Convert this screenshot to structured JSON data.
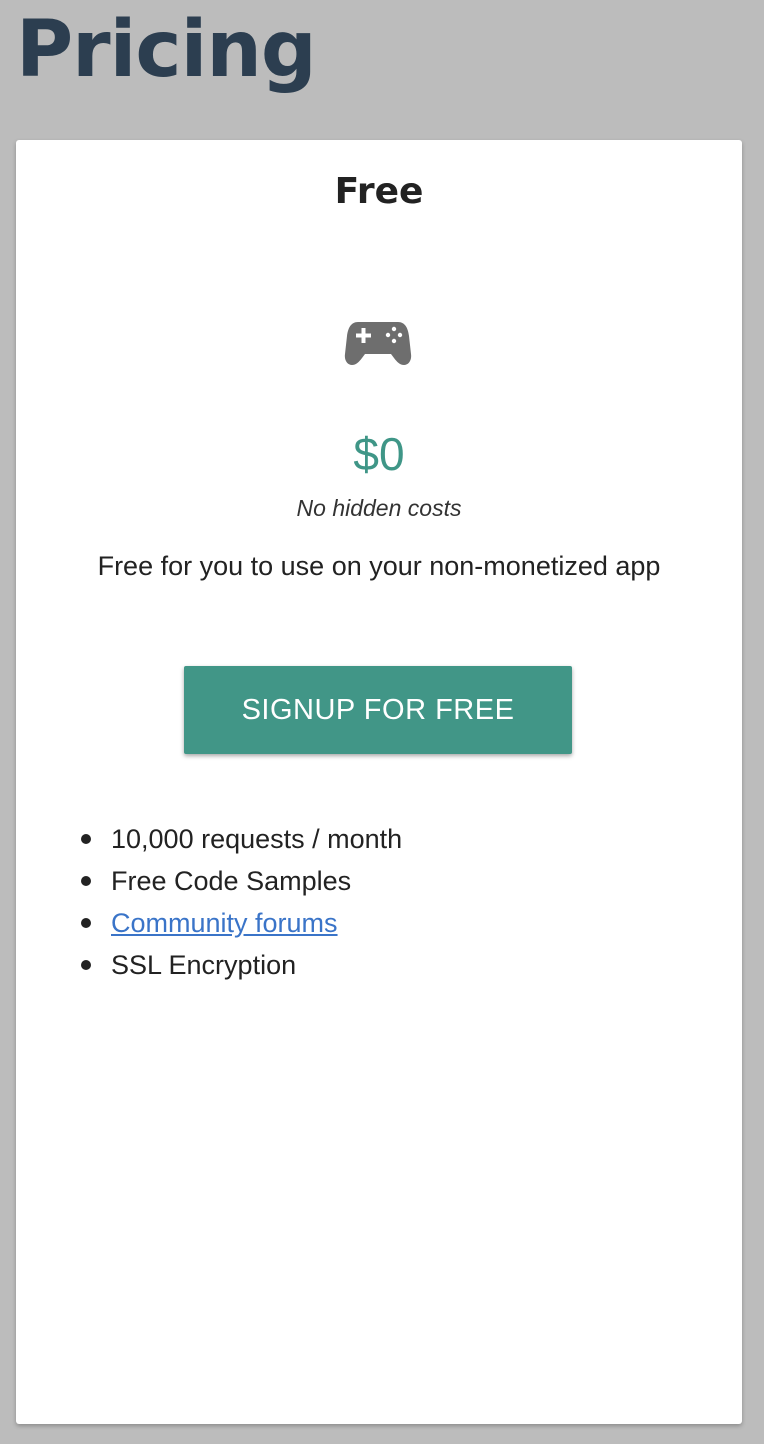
{
  "page": {
    "title": "Pricing"
  },
  "plan": {
    "name": "Free",
    "icon": "gamepad-icon",
    "price": "$0",
    "price_note": "No hidden costs",
    "description": "Free for you to use on your non-monetized app",
    "signup_label": "SIGNUP FOR FREE",
    "features": [
      "10,000 requests / month",
      "Free Code Samples",
      "Community forums",
      "SSL Encryption"
    ]
  },
  "colors": {
    "background": "#bcbcbc",
    "title": "#2c3e50",
    "accent": "#419687",
    "link": "#3a74c8",
    "icon": "#6e6e6e"
  }
}
